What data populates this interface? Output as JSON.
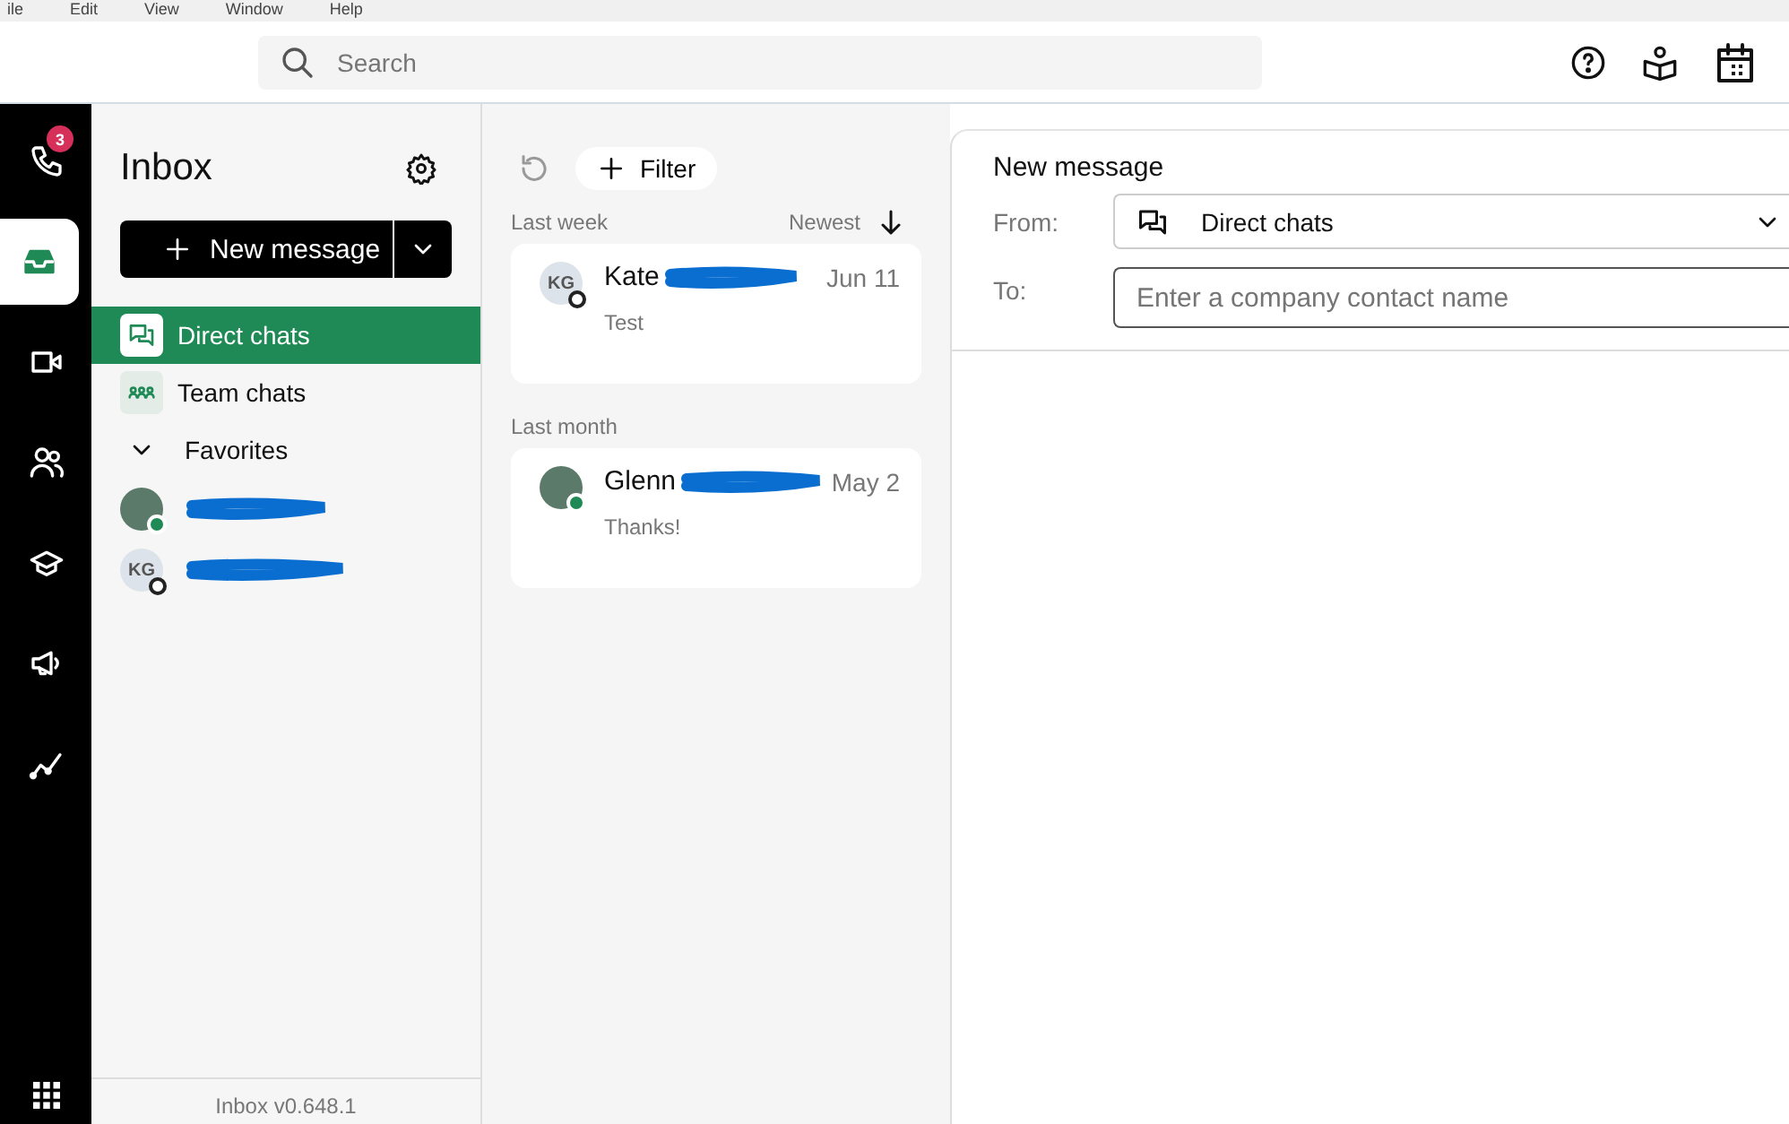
{
  "menu_bar": [
    "ile",
    "Edit",
    "View",
    "Window",
    "Help"
  ],
  "search": {
    "placeholder": "Search"
  },
  "rail": {
    "items": [
      {
        "badge": "3",
        "selected": false
      },
      {
        "selected": true
      },
      {
        "selected": false
      },
      {
        "selected": false
      },
      {
        "selected": false
      },
      {
        "selected": false
      },
      {
        "selected": false
      }
    ]
  },
  "sidebar": {
    "title": "Inbox",
    "new_message": "New message",
    "items": [
      {
        "label": "Direct chats",
        "selected": true
      },
      {
        "label": "Team chats",
        "selected": false
      }
    ],
    "favorites": {
      "label": "Favorites",
      "expanded": true,
      "contacts": [
        {
          "kind": "photo",
          "online": true
        },
        {
          "kind": "initials",
          "initials": "KG",
          "online": false
        }
      ]
    },
    "footer": "Inbox v0.648.1"
  },
  "list": {
    "filter": "Filter",
    "sort": "Newest",
    "groups": [
      {
        "label": "Last week",
        "items": [
          {
            "name": "Kate",
            "kind": "initials",
            "initials": "KG",
            "online": false,
            "date": "Jun 11",
            "preview": "Test"
          }
        ]
      },
      {
        "label": "Last month",
        "items": [
          {
            "name": "Glenn",
            "kind": "photo",
            "online": true,
            "date": "May 2",
            "preview": "Thanks!"
          }
        ]
      }
    ]
  },
  "compose": {
    "title": "New message",
    "from_label": "From:",
    "from_value": "Direct chats",
    "to_label": "To:",
    "to_placeholder": "Enter a company contact name"
  }
}
